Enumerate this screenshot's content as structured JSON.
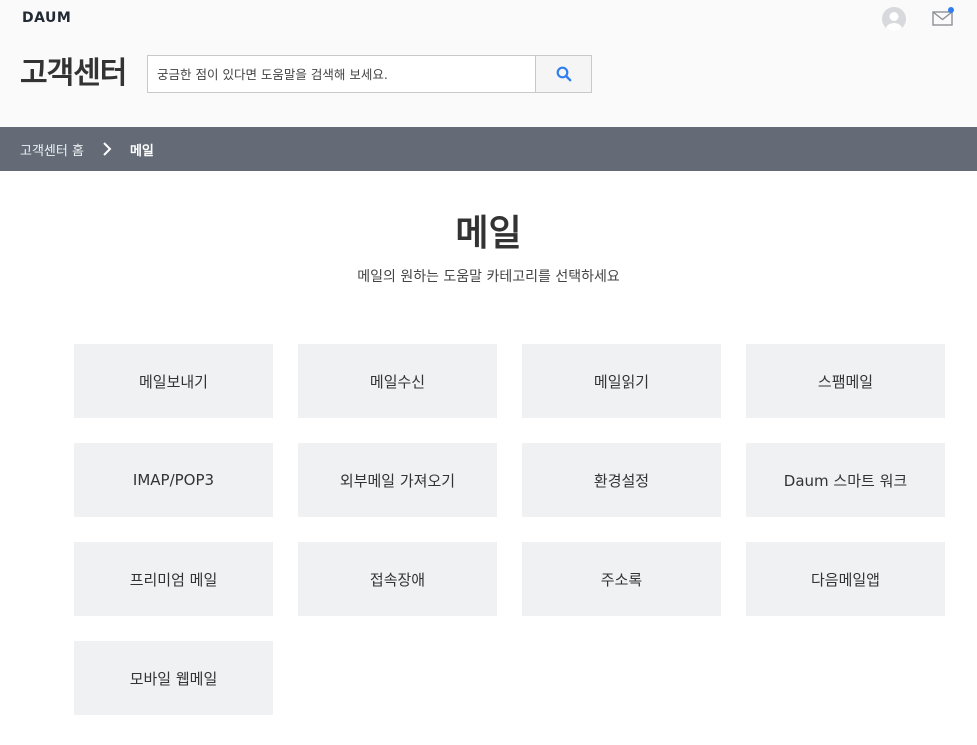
{
  "header": {
    "logo": "DAUM",
    "title": "고객센터",
    "search": {
      "placeholder": "궁금한 점이 있다면 도움말을 검색해 보세요.",
      "value": ""
    }
  },
  "breadcrumb": {
    "home": "고객센터 홈",
    "current": "메일"
  },
  "section": {
    "title": "메일",
    "subtitle": "메일의 원하는 도움말 카테고리를 선택하세요"
  },
  "categories": [
    "메일보내기",
    "메일수신",
    "메일읽기",
    "스팸메일",
    "IMAP/POP3",
    "외부메일 가져오기",
    "환경설정",
    "Daum 스마트 워크",
    "프리미엄 메일",
    "접속장애",
    "주소록",
    "다음메일앱",
    "모바일 웹메일"
  ],
  "icons": {
    "user": "avatar-icon",
    "mail": "mail-icon",
    "search": "search-icon",
    "separator": "chevron-right-icon"
  },
  "colors": {
    "header_bg": "#fafafa",
    "breadcrumb_bg": "#646b77",
    "tile_bg": "#f0f1f3",
    "accent": "#2f7ef1"
  }
}
